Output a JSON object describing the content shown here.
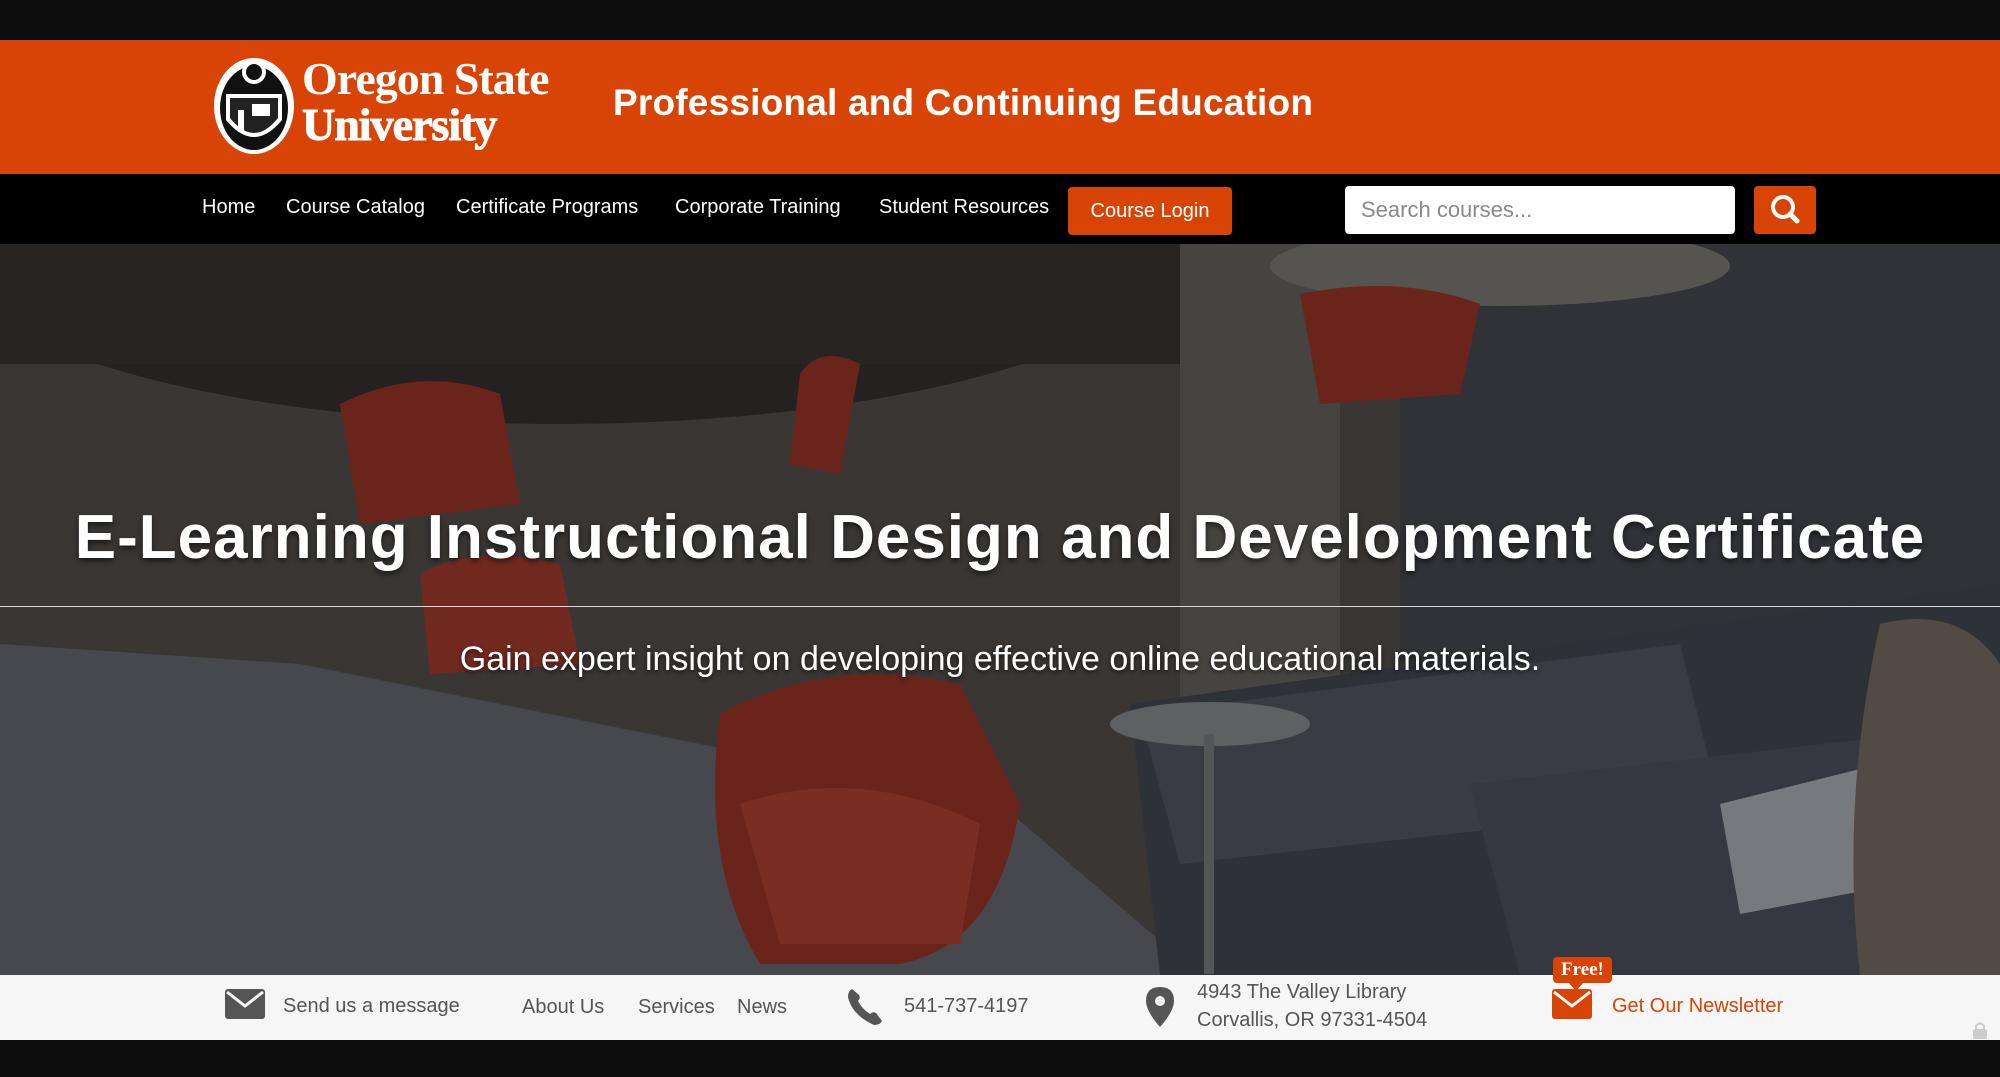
{
  "header": {
    "logo_line1": "Oregon State",
    "logo_line2": "University",
    "site_title": "Professional and Continuing Education"
  },
  "nav": {
    "items": [
      {
        "label": "Home"
      },
      {
        "label": "Course Catalog"
      },
      {
        "label": "Certificate Programs"
      },
      {
        "label": "Corporate Training"
      },
      {
        "label": "Student Resources"
      }
    ],
    "login_label": "Course Login",
    "search_placeholder": "Search courses..."
  },
  "hero": {
    "title": "E-Learning Instructional Design and Development Certificate",
    "subtitle": "Gain expert insight on developing effective online educational materials."
  },
  "footer": {
    "message_label": "Send us a message",
    "links": [
      {
        "label": "About Us"
      },
      {
        "label": "Services"
      },
      {
        "label": "News"
      }
    ],
    "phone": "541-737-4197",
    "address_line1": "4943 The Valley Library",
    "address_line2": "Corvallis, OR 97331-4504",
    "free_badge": "Free!",
    "newsletter_label": "Get Our Newsletter"
  },
  "colors": {
    "brand_orange": "#d84406",
    "nav_black": "#000000",
    "footer_bg": "#f6f6f6"
  },
  "icons": [
    "envelope-icon",
    "phone-icon",
    "map-pin-icon",
    "search-icon",
    "lock-icon"
  ]
}
